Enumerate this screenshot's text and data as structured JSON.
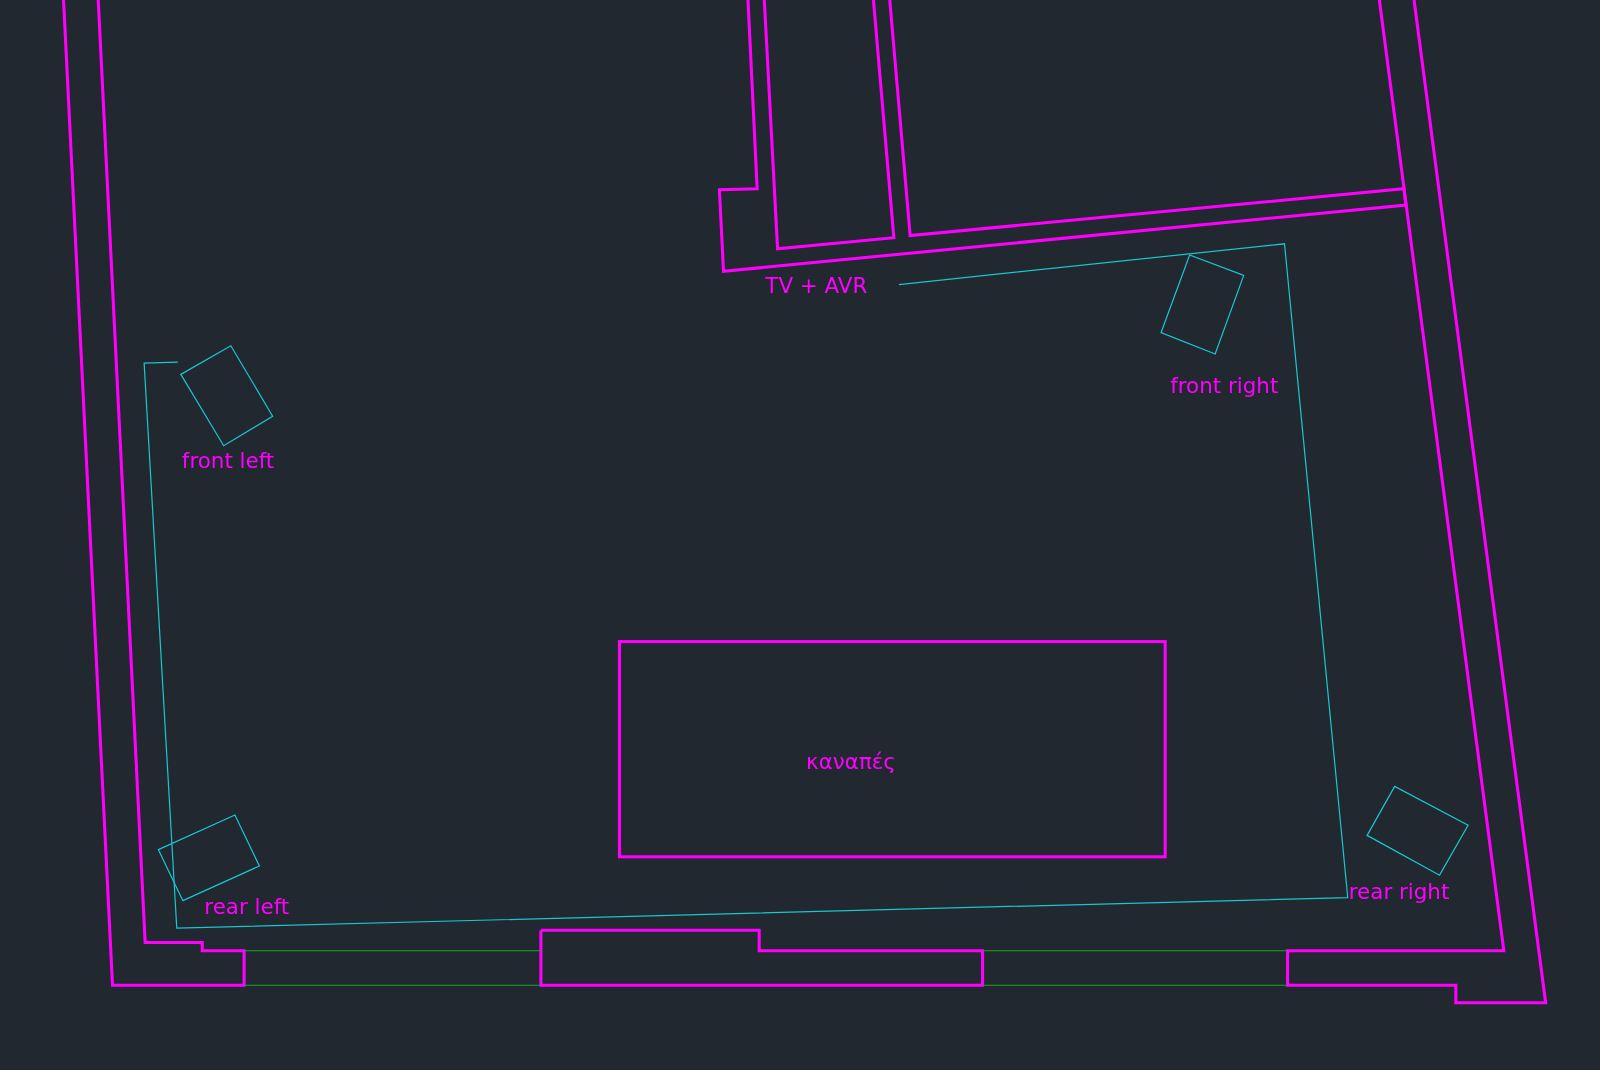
{
  "canvas": {
    "labels": [
      {
        "text": "TV + AVR"
      },
      {
        "text": "front right"
      },
      {
        "text": "front left"
      },
      {
        "text": "καναπές"
      },
      {
        "text": "rear left"
      },
      {
        "text": "rear right"
      }
    ]
  }
}
